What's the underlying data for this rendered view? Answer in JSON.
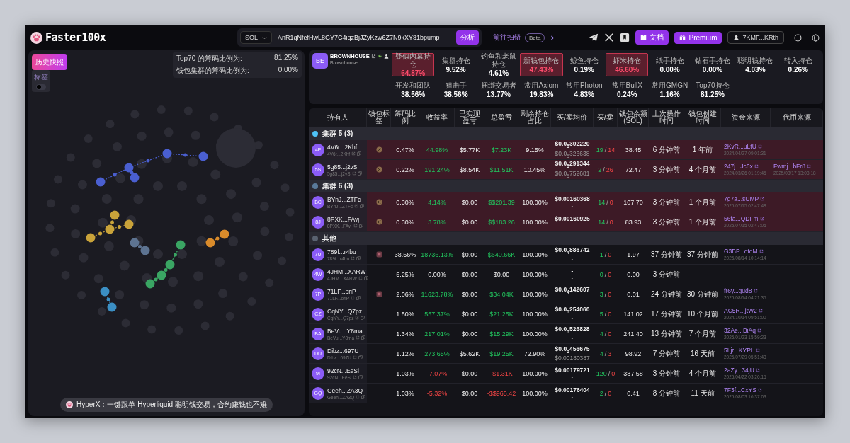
{
  "header": {
    "logo": "Faster100x",
    "chain": "SOL",
    "address": "AnR1qNfefHwL8GY7C4iqzBjJZyKzw6Z7N9kXY81bpump",
    "analyze": "分析",
    "scan_link": "前往扫链",
    "scan_badge": "Beta",
    "docs": "文档",
    "premium": "Premium",
    "wallet": "7KMF...KRth"
  },
  "left_panel": {
    "snapshot": "历史快照",
    "toggle": {
      "label": "标签",
      "on": false
    },
    "ratios": [
      {
        "label": "Top70 的筹码比例为:",
        "value": "81.25%"
      },
      {
        "label": "钱包集群的筹码比例为:",
        "value": "0.00%"
      }
    ],
    "graph": {
      "clusters": [
        {
          "color": "#4a5fd0"
        },
        {
          "color": "#c9a33a"
        },
        {
          "color": "#d98b2b"
        },
        {
          "color": "#3aa563"
        },
        {
          "color": "#3b8fc4"
        },
        {
          "color": "#5d7391"
        }
      ]
    },
    "banner": "HyperX：一键跟单 Hyperliquid 聪明钱交易，合约赚钱也不难"
  },
  "token": {
    "avatar": "BE",
    "name": "BROWNHOUSE",
    "subtitle": "Brownhouse"
  },
  "stats": [
    {
      "label": "疑似内幕持仓",
      "value": "64.87%",
      "highlighted": true
    },
    {
      "label": "集群持仓",
      "value": "9.52%",
      "highlighted": false
    },
    {
      "label": "钓鱼和老鼠持仓",
      "value": "4.61%",
      "highlighted": false
    },
    {
      "label": "新钱包持仓",
      "value": "47.43%",
      "highlighted": true
    },
    {
      "label": "鲸鱼持仓",
      "value": "0.19%",
      "highlighted": false
    },
    {
      "label": "虾米持仓",
      "value": "46.60%",
      "highlighted": true
    },
    {
      "label": "纸手持仓",
      "value": "0.00%",
      "highlighted": false
    },
    {
      "label": "钻石手持仓",
      "value": "0.00%",
      "highlighted": false
    },
    {
      "label": "聪明钱持仓",
      "value": "4.03%",
      "highlighted": false
    },
    {
      "label": "转入持仓",
      "value": "0.26%",
      "highlighted": false
    },
    {
      "label": "开发和团队",
      "value": "38.56%",
      "highlighted": false
    },
    {
      "label": "狙击手",
      "value": "38.56%",
      "highlighted": false
    },
    {
      "label": "捆绑交易者",
      "value": "13.77%",
      "highlighted": false
    },
    {
      "label": "常用Axiom",
      "value": "19.83%",
      "highlighted": false
    },
    {
      "label": "常用Photon",
      "value": "4.83%",
      "highlighted": false
    },
    {
      "label": "常用BullX",
      "value": "0.24%",
      "highlighted": false
    },
    {
      "label": "常用GMGN",
      "value": "1.16%",
      "highlighted": false
    },
    {
      "label": "Top70持仓",
      "value": "81.25%",
      "highlighted": false
    }
  ],
  "table": {
    "columns": [
      "持有人",
      "钱包标签",
      "筹码比例",
      "收益率",
      "已实现盈亏",
      "总盈亏",
      "剩余持仓占比",
      "买/卖均价",
      "买/卖",
      "钱包余额(SOL)",
      "上次操作时间",
      "钱包创建时间",
      "资金来源",
      "代币来源"
    ],
    "groups": [
      {
        "label": "集群 5 (3)",
        "color": "#4fc3f7",
        "highlighted": true,
        "rows": [
          {
            "avatar": "4F",
            "name": "4V6r...2Khf",
            "short": "4V6r...2Khf",
            "tag": {
              "kind": "coin"
            },
            "ratio": "0.47%",
            "rate": {
              "text": "44.98%",
              "kind": "gain"
            },
            "realized": "$5.77K",
            "total": {
              "text": "$7.23K",
              "kind": "gain"
            },
            "remain": "9.15%",
            "buy_avg": "$0.0$_{5}$302220",
            "sell_avg": "$0.0$_{5}$326638",
            "buys": "19",
            "sep": "/",
            "sells": "14",
            "balance": "38.45",
            "last_op": "6 分钟前",
            "created": "1 年前",
            "fund": {
              "link": "2KvR...uLtU",
              "date": "2024/04/27 09:01:31"
            }
          },
          {
            "avatar": "5S",
            "name": "5g85...j2vS",
            "short": "5g85...j2vS",
            "tag": {
              "kind": "coin"
            },
            "ratio": "0.22%",
            "rate": {
              "text": "191.24%",
              "kind": "gain"
            },
            "realized": "$8.54K",
            "total": {
              "text": "$11.51K",
              "kind": "gain"
            },
            "remain": "10.45%",
            "buy_avg": "$0.0$_{5}$291344",
            "sell_avg": "$0.0$_{5}$752681",
            "buys": "2",
            "sep": "/",
            "sells": "26",
            "balance": "72.47",
            "last_op": "3 分钟前",
            "created": "4 个月前",
            "fund": {
              "link": "247j...Jc6x",
              "date": "2024/03/26 01:19:45"
            },
            "token_source": {
              "link": "Fwmj...bFr8",
              "date": "2025/03/17 13:08:18"
            }
          }
        ]
      },
      {
        "label": "集群 6 (3)",
        "color": "#5a7a99",
        "highlighted": true,
        "rows": [
          {
            "avatar": "BC",
            "name": "BYnJ...ZTFc",
            "short": "BYnJ...ZTFc",
            "tag": {
              "kind": "coin"
            },
            "ratio": "0.30%",
            "rate": {
              "text": "4.14%",
              "kind": "gain"
            },
            "realized": "$0.00",
            "total": {
              "text": "$$201.39",
              "kind": "gain"
            },
            "remain": "100.00%",
            "buy_avg": "$0.00160368",
            "sell_avg": "-",
            "buys": "14",
            "sep": "/",
            "sells": "0",
            "balance": "107.70",
            "last_op": "3 分钟前",
            "created": "1 个月前",
            "fund": {
              "link": "7g7a...sUMP",
              "date": "2025/07/15 02:47:48"
            }
          },
          {
            "avatar": "8J",
            "name": "8PXK...FAvj",
            "short": "8PXK...FAvj",
            "tag": {
              "kind": "coin"
            },
            "ratio": "0.30%",
            "rate": {
              "text": "3.78%",
              "kind": "gain"
            },
            "realized": "$0.00",
            "total": {
              "text": "$$183.26",
              "kind": "gain"
            },
            "remain": "100.00%",
            "buy_avg": "$0.00160925",
            "sell_avg": "-",
            "buys": "14",
            "sep": "/",
            "sells": "0",
            "balance": "83.93",
            "last_op": "3 分钟前",
            "created": "1 个月前",
            "fund": {
              "link": "56fa...QDFm",
              "date": "2025/07/15 02:47:05"
            }
          }
        ]
      },
      {
        "label": "其他",
        "color": "#5a6270",
        "highlighted": false,
        "rows": [
          {
            "avatar": "7U",
            "name": "789f...r4bu",
            "short": "789f...r4bu",
            "tag": {
              "kind": "box"
            },
            "ratio": "38.56%",
            "rate": {
              "text": "18736.13%",
              "kind": "gain"
            },
            "realized": "$0.00",
            "total": {
              "text": "$640.66K",
              "kind": "gain"
            },
            "remain": "100.00%",
            "buy_avg": "$0.0$_{4}$886742",
            "sell_avg": "-",
            "buys": "1",
            "sep": "/",
            "sells": "0",
            "balance": "1.97",
            "last_op": "37 分钟前",
            "created": "37 分钟前",
            "fund": {
              "link": "G3BP...dtqM",
              "date": "2025/08/14 10:14:14"
            }
          },
          {
            "avatar": "4W",
            "name": "4JHM...XARW",
            "short": "4JHM...XARW",
            "ratio": "5.25%",
            "rate": {
              "text": "0.00%",
              "kind": "flat"
            },
            "realized": "$0.00",
            "total": {
              "text": "$0.00",
              "kind": "flat"
            },
            "remain": "100.00%",
            "buy_avg": "-",
            "sell_avg": "-",
            "buys": "0",
            "sep": "/",
            "sells": "0",
            "balance": "0.00",
            "last_op": "3 分钟前",
            "created": "-"
          },
          {
            "avatar": "7P",
            "name": "71LF...oriP",
            "short": "71LF...oriP",
            "tag": {
              "kind": "box"
            },
            "ratio": "2.06%",
            "rate": {
              "text": "11623.78%",
              "kind": "gain"
            },
            "realized": "$0.00",
            "total": {
              "text": "$34.04K",
              "kind": "gain"
            },
            "remain": "100.00%",
            "buy_avg": "$0.0$_{4}$142607",
            "sell_avg": "-",
            "buys": "3",
            "sep": "/",
            "sells": "0",
            "balance": "0.01",
            "last_op": "24 分钟前",
            "created": "30 分钟前",
            "fund": {
              "link": "fr6y...gud8",
              "date": "2025/08/14 04:21:35"
            }
          },
          {
            "avatar": "CZ",
            "name": "CqNY...Q7pz",
            "short": "CqNY...Q7pz",
            "ratio": "1.50%",
            "rate": {
              "text": "557.37%",
              "kind": "gain"
            },
            "realized": "$0.00",
            "total": {
              "text": "$21.25K",
              "kind": "gain"
            },
            "remain": "100.00%",
            "buy_avg": "$0.0$_{5}$254060",
            "sell_avg": "-",
            "buys": "5",
            "sep": "/",
            "sells": "0",
            "balance": "141.02",
            "last_op": "17 分钟前",
            "created": "10 个月前",
            "fund": {
              "link": "AC5R...jtW2",
              "date": "2024/10/14 09:51:00"
            }
          },
          {
            "avatar": "BA",
            "name": "BeVu...Y8ma",
            "short": "BeVu...Y8ma",
            "ratio": "1.34%",
            "rate": {
              "text": "217.01%",
              "kind": "gain"
            },
            "realized": "$0.00",
            "total": {
              "text": "$15.29K",
              "kind": "gain"
            },
            "remain": "100.00%",
            "buy_avg": "$0.0$_{5}$526828",
            "sell_avg": "-",
            "buys": "4",
            "sep": "/",
            "sells": "0",
            "balance": "241.40",
            "last_op": "13 分钟前",
            "created": "7 个月前",
            "fund": {
              "link": "32Ae...BiAq",
              "date": "2025/01/23 15:59:23"
            }
          },
          {
            "avatar": "DU",
            "name": "Dibz...697U",
            "short": "Dibz...697U",
            "ratio": "1.12%",
            "rate": {
              "text": "273.65%",
              "kind": "gain"
            },
            "realized": "$5.62K",
            "total": {
              "text": "$19.25K",
              "kind": "gain"
            },
            "remain": "72.90%",
            "buy_avg": "$0.0$_{5}$456675",
            "sell_avg": "$0.00180387",
            "buys": "4",
            "sep": "/",
            "sells": "3",
            "balance": "98.92",
            "last_op": "7 分钟前",
            "created": "16 天前",
            "fund": {
              "link": "5Ljr...KYPL",
              "date": "2025/07/29 05:51:48"
            }
          },
          {
            "avatar": "9I",
            "name": "92cN...EeSi",
            "short": "92cN...EeSi",
            "ratio": "1.03%",
            "rate": {
              "text": "-7.07%",
              "kind": "loss"
            },
            "realized": "$0.00",
            "total": {
              "text": "-$1.31K",
              "kind": "loss"
            },
            "remain": "100.00%",
            "buy_avg": "$0.00179721",
            "sell_avg": "-",
            "buys": "120",
            "sep": "/",
            "sells": "0",
            "balance": "387.58",
            "last_op": "3 分钟前",
            "created": "4 个月前",
            "fund": {
              "link": "2aZy...34jU",
              "date": "2025/04/22 03:26:15"
            }
          },
          {
            "avatar": "GQ",
            "name": "Geeh...ZA3Q",
            "short": "Geeh...ZA3Q",
            "ratio": "1.03%",
            "rate": {
              "text": "-5.32%",
              "kind": "loss"
            },
            "realized": "$0.00",
            "total": {
              "text": "-$$965.42",
              "kind": "loss"
            },
            "remain": "100.00%",
            "buy_avg": "$0.00176404",
            "sell_avg": "-",
            "buys": "2",
            "sep": "/",
            "sells": "0",
            "balance": "0.41",
            "last_op": "8 分钟前",
            "created": "11 天前",
            "fund": {
              "link": "7F3f...CxYS",
              "date": "2025/08/03 16:37:03"
            }
          }
        ]
      }
    ]
  }
}
